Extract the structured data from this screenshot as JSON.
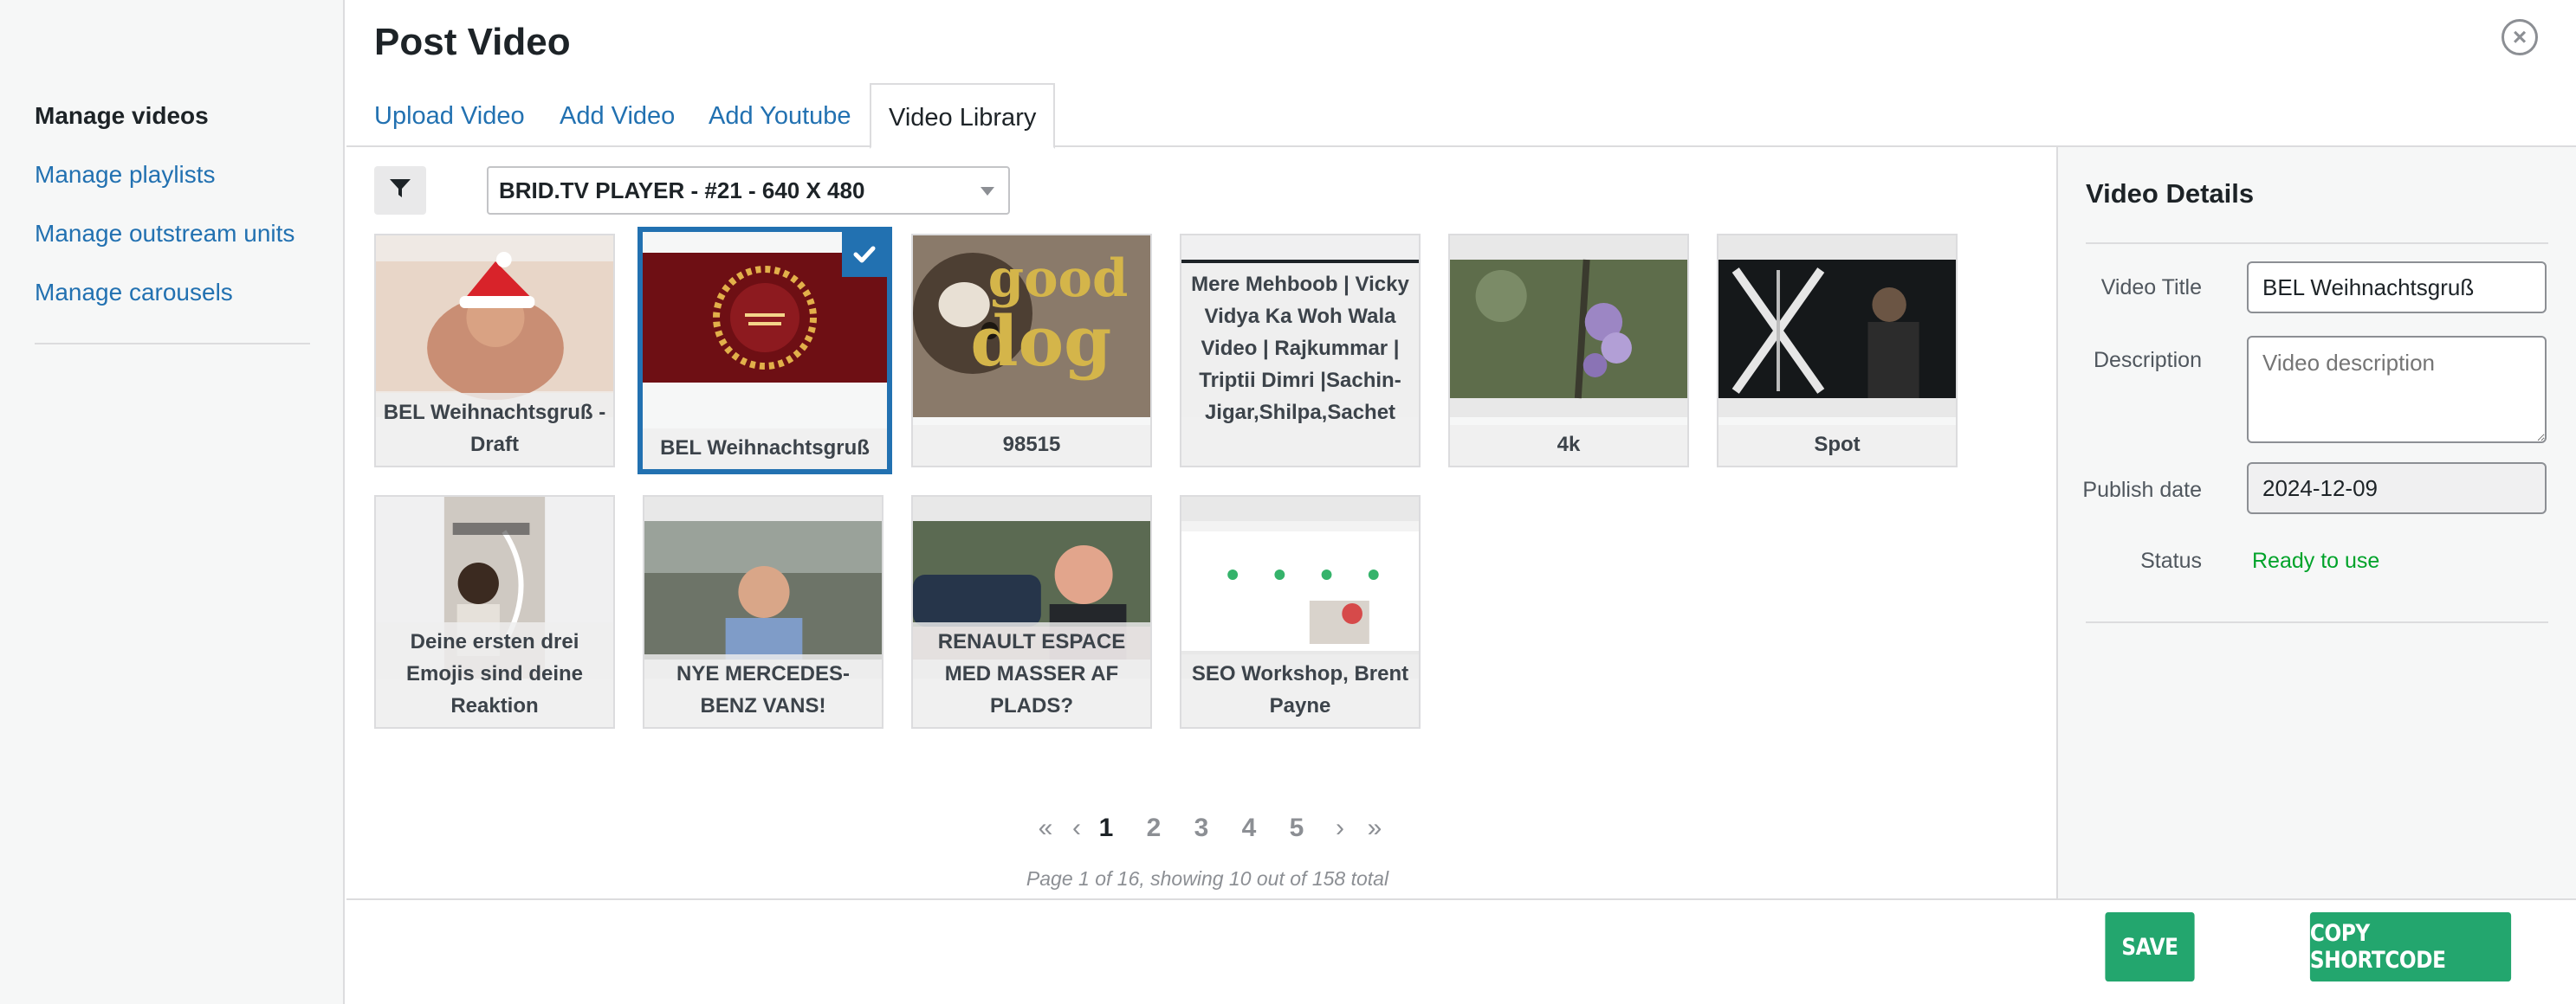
{
  "sidebar": {
    "items": [
      {
        "label": "Manage videos",
        "active": true
      },
      {
        "label": "Manage playlists"
      },
      {
        "label": "Manage outstream units"
      },
      {
        "label": "Manage carousels"
      }
    ]
  },
  "modal": {
    "title": "Post Video",
    "close_icon": "×"
  },
  "tabs": [
    {
      "label": "Upload Video"
    },
    {
      "label": "Add Video"
    },
    {
      "label": "Add Youtube"
    },
    {
      "label": "Video Library",
      "active": true
    }
  ],
  "library": {
    "filter_icon": "filter-icon",
    "player_select": "BRID.TV PLAYER - #21 - 640 X 480",
    "videos": [
      {
        "caption": "BEL Weihnachtsgruß - Draft"
      },
      {
        "caption": "BEL Weihnachtsgruß",
        "selected": true
      },
      {
        "caption": "98515",
        "thumb_text": "good dog"
      },
      {
        "caption": "Mere Mehboob | Vicky Vidya Ka Woh Wala Video | Rajkummar | Triptii Dimri |Sachin-Jigar,Shilpa,Sachet"
      },
      {
        "caption": "4k"
      },
      {
        "caption": "Spot"
      },
      {
        "caption": "Deine ersten drei Emojis sind deine Reaktion"
      },
      {
        "caption": "NYE MERCEDES-BENZ VANS!"
      },
      {
        "caption": "RENAULT ESPACE MED MASSER AF PLADS?"
      },
      {
        "caption": "SEO Workshop, Brent Payne"
      }
    ],
    "pagination": {
      "first": "«",
      "prev": "‹",
      "pages": [
        "1",
        "2",
        "3",
        "4",
        "5"
      ],
      "current": "1",
      "next": "›",
      "last": "»",
      "info": "Page 1 of 16, showing 10 out of 158 total"
    }
  },
  "details": {
    "title": "Video Details",
    "video_title_label": "Video Title",
    "video_title_value": "BEL Weihnachtsgruß",
    "description_label": "Description",
    "description_placeholder": "Video description",
    "publish_date_label": "Publish date",
    "publish_date_value": "2024-12-09",
    "status_label": "Status",
    "status_value": "Ready to use"
  },
  "footer": {
    "save_label": "SAVE",
    "copy_label": "COPY SHORTCODE"
  },
  "colors": {
    "link": "#2271b1",
    "success": "#00a32a",
    "button_green": "#23a66e",
    "selected_border": "#2271b1"
  }
}
